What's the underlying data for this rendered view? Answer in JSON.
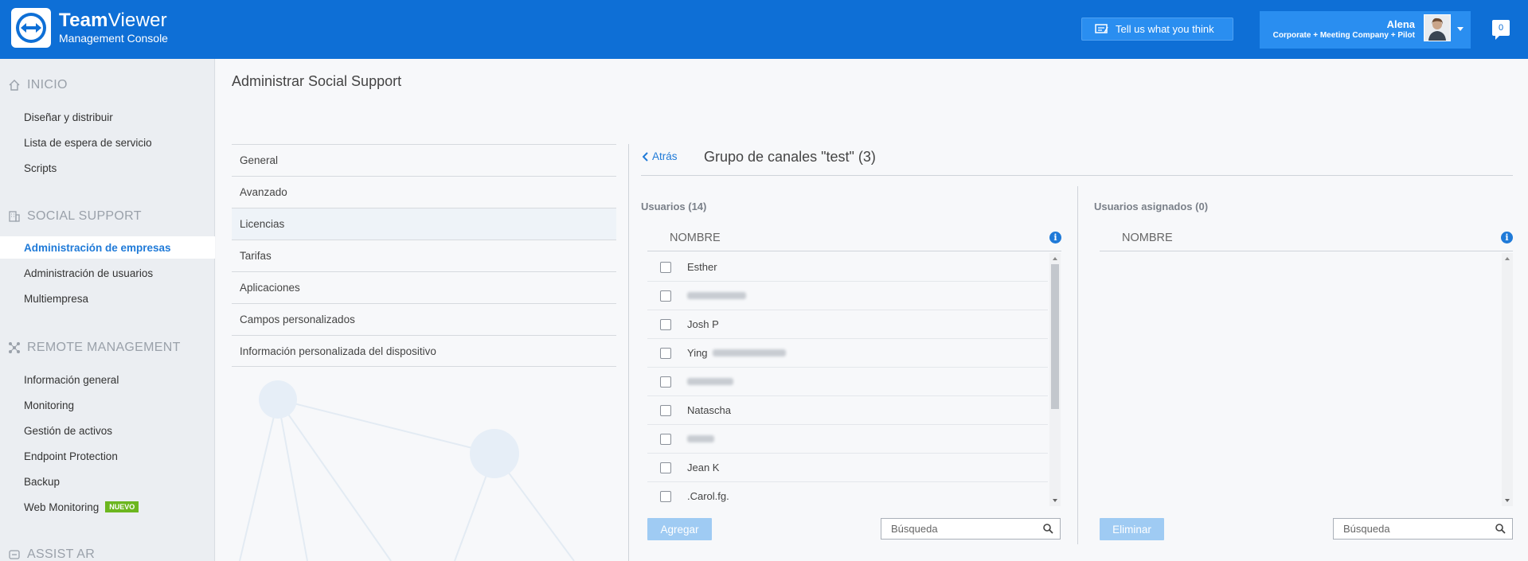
{
  "header": {
    "brand_bold": "Team",
    "brand_light": "Viewer",
    "brand_sub": "Management Console",
    "feedback_label": "Tell us what you think",
    "user_name": "Alena",
    "user_company": "Corporate + Meeting Company + Pilot",
    "notif_count": "0",
    "accent": "#0e6fd6"
  },
  "sidebar": {
    "sections": [
      {
        "title": "INICIO",
        "icon": "home-icon",
        "items": [
          "Diseñar y distribuir",
          "Lista de espera de servicio",
          "Scripts"
        ]
      },
      {
        "title": "SOCIAL SUPPORT",
        "icon": "building-icon",
        "items": [
          "Administración de empresas",
          "Administración de usuarios",
          "Multiempresa"
        ]
      },
      {
        "title": "REMOTE MANAGEMENT",
        "icon": "network-icon",
        "items": [
          "Información general",
          "Monitoring",
          "Gestión de activos",
          "Endpoint Protection",
          "Backup",
          "Web Monitoring"
        ]
      },
      {
        "title": "ASSIST AR",
        "icon": "ar-icon",
        "items": []
      }
    ],
    "active_item": "Administración de empresas",
    "new_badge": "NUEVO"
  },
  "page": {
    "title": "Administrar Social Support",
    "menu": [
      "General",
      "Avanzado",
      "Licencias",
      "Tarifas",
      "Aplicaciones",
      "Campos personalizados",
      "Información personalizada del dispositivo"
    ]
  },
  "panel": {
    "back_label": "Atrás",
    "group_title": "Grupo de canales \"test\" (3)",
    "left": {
      "label": "Usuarios (14)",
      "column": "NOMBRE",
      "rows": [
        "Esther",
        "",
        "Josh P",
        "Ying",
        "",
        "Natascha",
        "",
        "Jean K",
        ".Carol.fg."
      ],
      "button": "Agregar",
      "search_placeholder": "Búsqueda"
    },
    "right": {
      "label": "Usuarios asignados (0)",
      "column": "NOMBRE",
      "button": "Eliminar",
      "search_placeholder": "Búsqueda"
    }
  }
}
